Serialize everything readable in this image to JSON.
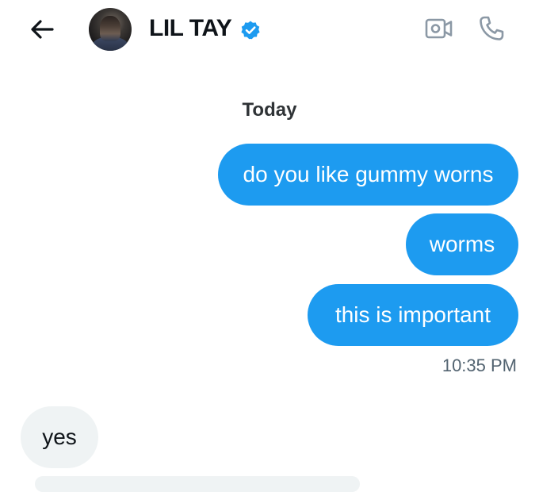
{
  "header": {
    "contact_name": "LIL TAY",
    "icons": {
      "back": "back-arrow-icon",
      "verified": "verified-badge-icon",
      "video": "video-camera-icon",
      "call": "phone-icon"
    },
    "colors": {
      "verified": "#1d9bf0",
      "icon_muted": "#8b98a5"
    }
  },
  "conversation": {
    "date_label": "Today",
    "messages": [
      {
        "direction": "outgoing",
        "text": "do you like gummy worns"
      },
      {
        "direction": "outgoing",
        "text": "worms"
      },
      {
        "direction": "outgoing",
        "text": "this is important"
      },
      {
        "direction": "incoming",
        "text": "yes"
      }
    ],
    "timestamp": "10:35 PM"
  },
  "colors": {
    "outgoing_bubble": "#1d9bf0",
    "incoming_bubble": "#eff3f4",
    "timestamp_text": "#536471"
  }
}
